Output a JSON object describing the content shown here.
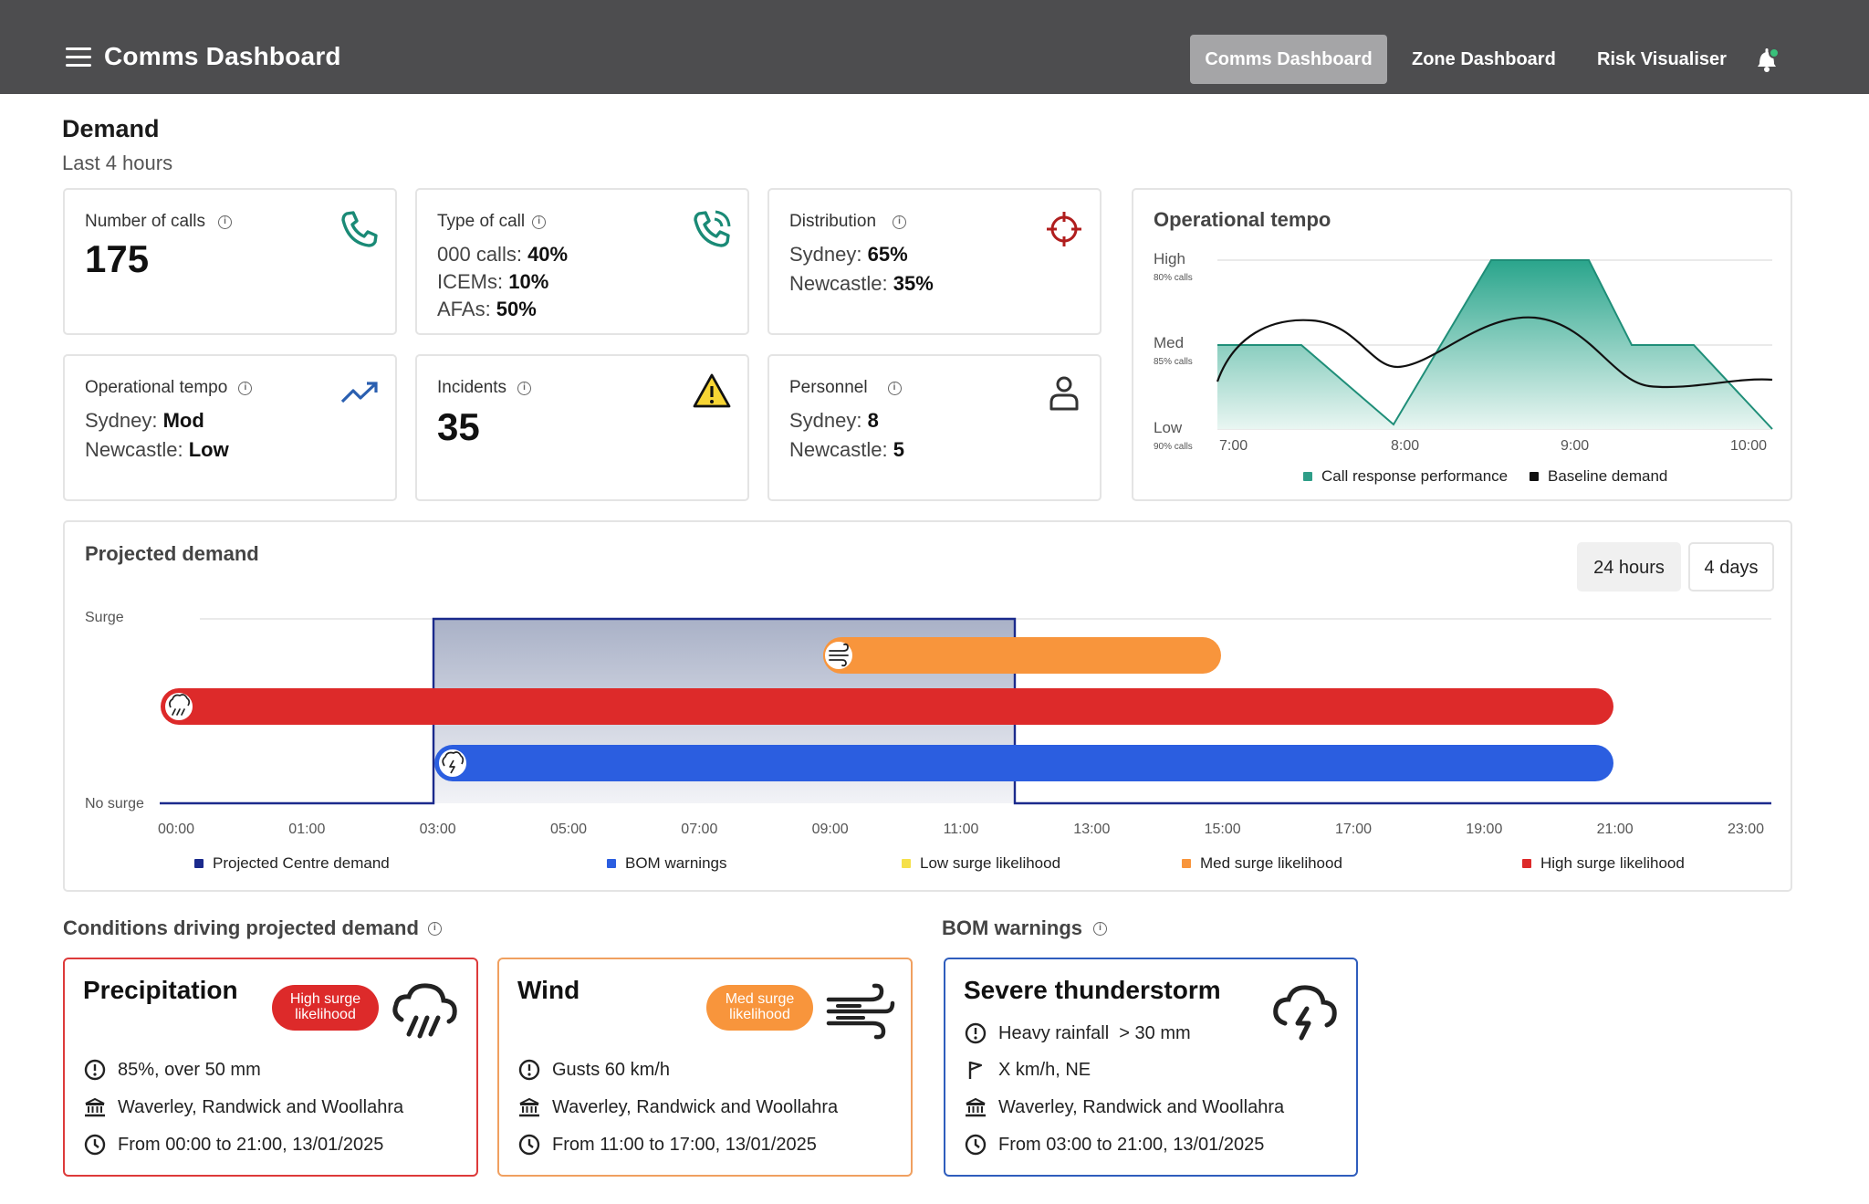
{
  "header": {
    "app_title": "Comms Dashboard",
    "nav": [
      "Comms Dashboard",
      "Zone Dashboard",
      "Risk Visualiser"
    ],
    "active_nav": "Comms Dashboard"
  },
  "demand": {
    "title": "Demand",
    "subtitle": "Last 4 hours"
  },
  "cards": {
    "calls": {
      "label": "Number of calls",
      "value": "175",
      "icon": "phone-icon"
    },
    "type": {
      "label": "Type of call",
      "icon": "phone-ringing-icon",
      "rows": [
        {
          "k": "000 calls: ",
          "v": "40%"
        },
        {
          "k": "ICEMs: ",
          "v": "10%"
        },
        {
          "k": "AFAs: ",
          "v": "50%"
        }
      ]
    },
    "distribution": {
      "label": "Distribution",
      "icon": "crosshair-icon",
      "rows": [
        {
          "k": "Sydney: ",
          "v": "65%"
        },
        {
          "k": "Newcastle: ",
          "v": "35%"
        }
      ]
    },
    "tempo": {
      "label": "Operational tempo",
      "icon": "trending-up-icon",
      "rows": [
        {
          "k": "Sydney: ",
          "v": "Mod"
        },
        {
          "k": "Newcastle: ",
          "v": "Low"
        }
      ]
    },
    "incidents": {
      "label": "Incidents",
      "value": "35",
      "icon": "warning-icon"
    },
    "personnel": {
      "label": "Personnel",
      "icon": "person-icon",
      "rows": [
        {
          "k": "Sydney: ",
          "v": "8"
        },
        {
          "k": "Newcastle: ",
          "v": "5"
        }
      ]
    }
  },
  "tempo_chart": {
    "title": "Operational tempo",
    "levels": [
      {
        "label": "High",
        "sub": "80% calls"
      },
      {
        "label": "Med",
        "sub": "85% calls"
      },
      {
        "label": "Low",
        "sub": "90% calls"
      }
    ],
    "x_ticks": [
      "7:00",
      "8:00",
      "9:00",
      "10:00"
    ],
    "legend": [
      {
        "label": "Call response performance",
        "color": "#2f9e88"
      },
      {
        "label": "Baseline demand",
        "color": "#111111"
      }
    ]
  },
  "projected": {
    "title": "Projected demand",
    "buttons": [
      "24 hours",
      "4 days"
    ],
    "active_button": "24 hours",
    "y_top": "Surge",
    "y_bottom": "No surge",
    "x_ticks": [
      "00:00",
      "01:00",
      "03:00",
      "05:00",
      "07:00",
      "09:00",
      "11:00",
      "13:00",
      "15:00",
      "17:00",
      "19:00",
      "21:00",
      "23:00"
    ],
    "legend": [
      {
        "label": "Projected Centre demand",
        "color": "#1b2a8c"
      },
      {
        "label": "BOM warnings",
        "color": "#2b5ee0"
      },
      {
        "label": "Low surge likelihood",
        "color": "#f5e04a"
      },
      {
        "label": "Med surge likelihood",
        "color": "#f8953c"
      },
      {
        "label": "High surge likelihood",
        "color": "#dd2a2a"
      }
    ]
  },
  "conditions": {
    "label": "Conditions driving projected demand",
    "cards": [
      {
        "title": "Precipitation",
        "pill": "High surge likelihood",
        "pill_color": "#dd2a2a",
        "border": "#dd3a3a",
        "icon": "rain-cloud-icon",
        "rows": [
          {
            "icon": "alert-circle-icon",
            "text": "85%, over 50 mm"
          },
          {
            "icon": "building-icon",
            "text": "Waverley, Randwick and Woollahra"
          },
          {
            "icon": "clock-icon",
            "text": "From 00:00 to 21:00, 13/01/2025"
          }
        ]
      },
      {
        "title": "Wind",
        "pill": "Med surge likelihood",
        "pill_color": "#f8953c",
        "border": "#f0a060",
        "icon": "wind-icon",
        "rows": [
          {
            "icon": "alert-circle-icon",
            "text": "Gusts 60 km/h"
          },
          {
            "icon": "building-icon",
            "text": "Waverley, Randwick and Woollahra"
          },
          {
            "icon": "clock-icon",
            "text": "From 11:00 to 17:00, 13/01/2025"
          }
        ]
      }
    ]
  },
  "bom": {
    "label": "BOM warnings",
    "card": {
      "title": "Severe thunderstorm",
      "icon": "thunderstorm-icon",
      "rows": [
        {
          "icon": "alert-circle-icon",
          "text": "Heavy rainfall  > 30 mm"
        },
        {
          "icon": "flag-icon",
          "text": "X km/h, NE"
        },
        {
          "icon": "building-icon",
          "text": "Waverley, Randwick and Woollahra"
        },
        {
          "icon": "clock-icon",
          "text": "From 03:00 to 21:00, 13/01/2025"
        }
      ]
    }
  }
}
